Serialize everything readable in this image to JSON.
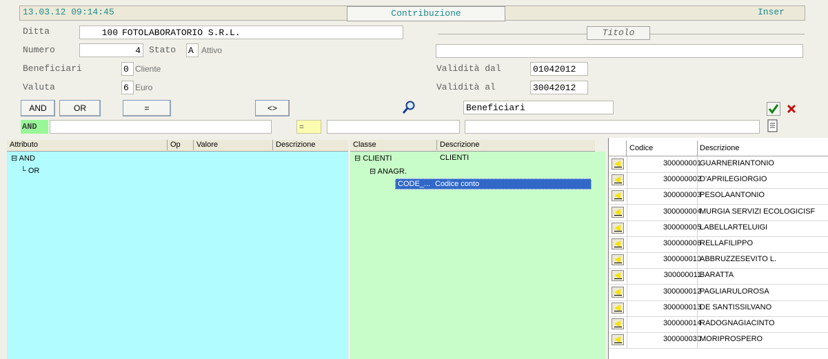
{
  "header": {
    "datetime": "13.03.12 09:14:45",
    "title": "Contribuzione",
    "mode": "Inser"
  },
  "form": {
    "ditta_label": "Ditta",
    "ditta_code": "100",
    "ditta_name": "FOTOLABORATORIO S.R.L.",
    "numero_label": "Numero",
    "numero_value": "4",
    "stato_label": "Stato",
    "stato_value": "A",
    "stato_text": "Attivo",
    "beneficiari_label": "Beneficiari",
    "beneficiari_value": "0",
    "beneficiari_text": "Cliente",
    "valuta_label": "Valuta",
    "valuta_value": "6",
    "valuta_text": "Euro",
    "titolo_label": "Titolo",
    "titolo_value": "",
    "validita_dal_label": "Validità dal",
    "validita_dal_value": "01042012",
    "validita_al_label": "Validità  al",
    "validita_al_value": "30042012"
  },
  "toolbar": {
    "and_label": "AND",
    "or_label": "OR",
    "eq_label": "=",
    "neq_label": "<>",
    "beneficiari_field": "Beneficiari",
    "and_tag": "AND",
    "eq_tag": "="
  },
  "left_table": {
    "columns": [
      "Attributo",
      "Op",
      "Valore",
      "Descrizione"
    ],
    "tree": [
      "AND",
      "OR"
    ]
  },
  "mid_table": {
    "columns": [
      "Classe",
      "Descrizione"
    ],
    "rows": [
      {
        "classe": "CLIENTI",
        "descrizione": "CLIENTI"
      },
      {
        "classe": "ANAGR.",
        "descrizione": ""
      },
      {
        "classe": "CODE_...",
        "descrizione": "Codice conto"
      }
    ]
  },
  "grid": {
    "columns": [
      "Codice",
      "Descrizione"
    ],
    "rows": [
      {
        "codice": "300000001",
        "descrizione": "GUARNERIANTONIO"
      },
      {
        "codice": "300000002",
        "descrizione": "D'APRILEGIORGIO"
      },
      {
        "codice": "300000003",
        "descrizione": "PESOLAANTONIO"
      },
      {
        "codice": "300000004",
        "descrizione": "MURGIA SERVIZI ECOLOGICISF"
      },
      {
        "codice": "300000005",
        "descrizione": "LABELLARTELUIGI"
      },
      {
        "codice": "300000006",
        "descrizione": "RELLAFILIPPO"
      },
      {
        "codice": "300000010",
        "descrizione": "ABBRUZZESEVITO L."
      },
      {
        "codice": "300000011",
        "descrizione": "BARATTA"
      },
      {
        "codice": "300000012",
        "descrizione": "PAGLIARULOROSA"
      },
      {
        "codice": "300000013",
        "descrizione": "DE SANTISSILVANO"
      },
      {
        "codice": "300000014",
        "descrizione": "RADOGNAGIACINTO"
      },
      {
        "codice": "300000030",
        "descrizione": "MORIPROSPERO"
      }
    ]
  },
  "colors": {
    "left_panel": "#b0fcff",
    "mid_panel": "#c8fcc8",
    "selection": "#3168c8",
    "header_teal": "#1a8c8c"
  }
}
